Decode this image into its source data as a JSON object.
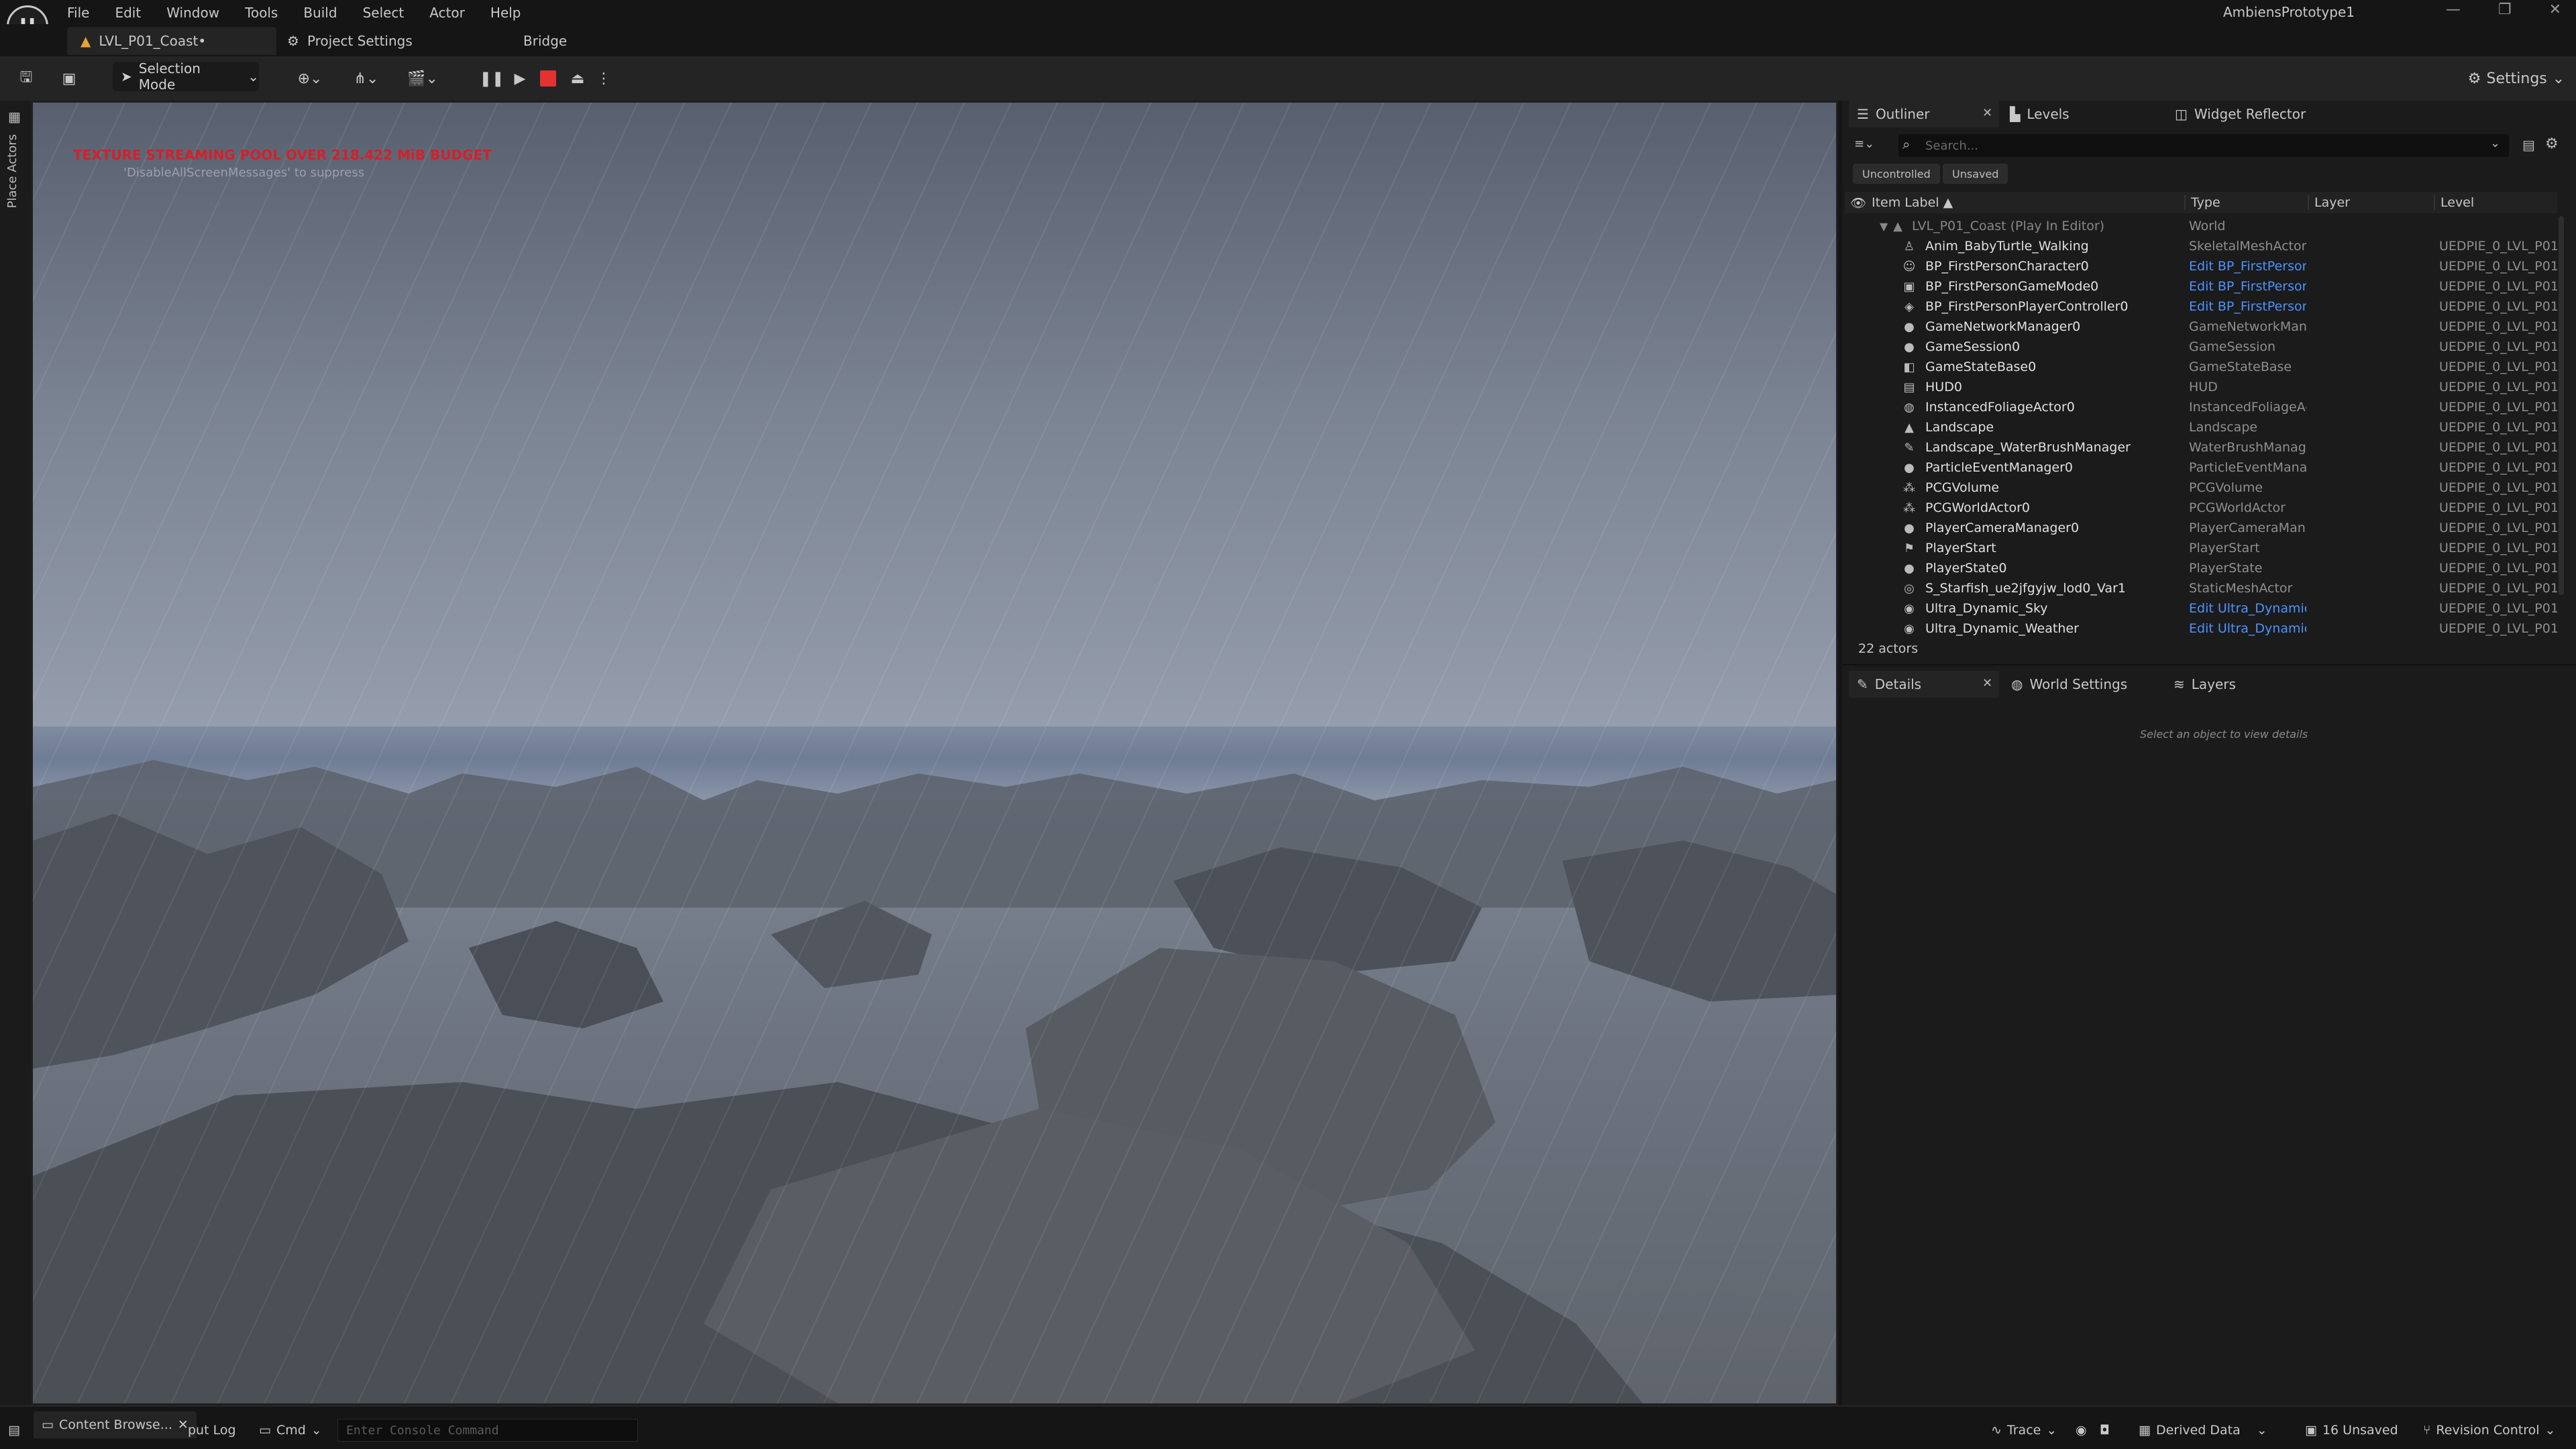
{
  "app": {
    "logo_text": "U",
    "title": "AmbiensPrototype1"
  },
  "menu": [
    "File",
    "Edit",
    "Window",
    "Tools",
    "Build",
    "Select",
    "Actor",
    "Help"
  ],
  "tabs": {
    "level": "LVL_P01_Coast•",
    "project_settings": "Project Settings",
    "bridge": "Bridge"
  },
  "toolbar": {
    "selection_mode": "Selection Mode",
    "settings": "Settings"
  },
  "left_strip": {
    "place_actors": "Place Actors"
  },
  "viewport": {
    "warning": "TEXTURE STREAMING POOL OVER 218.422 MiB BUDGET",
    "hint": "'DisableAllScreenMessages' to suppress"
  },
  "outliner": {
    "tabs": [
      "Outliner",
      "Levels",
      "Widget Reflector"
    ],
    "search_placeholder": "Search...",
    "chips": [
      "Uncontrolled",
      "Unsaved"
    ],
    "columns": {
      "label": "Item Label ▲",
      "type": "Type",
      "layer": "Layer",
      "level": "Level"
    },
    "world_row": {
      "label": "LVL_P01_Coast (Play In Editor)",
      "type": "World"
    },
    "rows": [
      {
        "icon": "skeletal-icon",
        "label": "Anim_BabyTurtle_Walking",
        "type": "SkeletalMeshActor",
        "link": false,
        "level": "UEDPIE_0_LVL_P01"
      },
      {
        "icon": "character-icon",
        "label": "BP_FirstPersonCharacter0",
        "type": "Edit BP_FirstPerson",
        "link": true,
        "level": "UEDPIE_0_LVL_P01"
      },
      {
        "icon": "gamemode-icon",
        "label": "BP_FirstPersonGameMode0",
        "type": "Edit BP_FirstPerson",
        "link": true,
        "level": "UEDPIE_0_LVL_P01"
      },
      {
        "icon": "controller-icon",
        "label": "BP_FirstPersonPlayerController0",
        "type": "Edit BP_FirstPerson",
        "link": true,
        "level": "UEDPIE_0_LVL_P01"
      },
      {
        "icon": "actor-icon",
        "label": "GameNetworkManager0",
        "type": "GameNetworkMana",
        "link": false,
        "level": "UEDPIE_0_LVL_P01"
      },
      {
        "icon": "actor-icon",
        "label": "GameSession0",
        "type": "GameSession",
        "link": false,
        "level": "UEDPIE_0_LVL_P01"
      },
      {
        "icon": "gamestate-icon",
        "label": "GameStateBase0",
        "type": "GameStateBase",
        "link": false,
        "level": "UEDPIE_0_LVL_P01"
      },
      {
        "icon": "hud-icon",
        "label": "HUD0",
        "type": "HUD",
        "link": false,
        "level": "UEDPIE_0_LVL_P01"
      },
      {
        "icon": "foliage-icon",
        "label": "InstancedFoliageActor0",
        "type": "InstancedFoliageAc",
        "link": false,
        "level": "UEDPIE_0_LVL_P01"
      },
      {
        "icon": "landscape-icon",
        "label": "Landscape",
        "type": "Landscape",
        "link": false,
        "level": "UEDPIE_0_LVL_P01"
      },
      {
        "icon": "brush-icon",
        "label": "Landscape_WaterBrushManager",
        "type": "WaterBrushManage",
        "link": false,
        "level": "UEDPIE_0_LVL_P01"
      },
      {
        "icon": "actor-icon",
        "label": "ParticleEventManager0",
        "type": "ParticleEventManag",
        "link": false,
        "level": "UEDPIE_0_LVL_P01"
      },
      {
        "icon": "pcg-icon",
        "label": "PCGVolume",
        "type": "PCGVolume",
        "link": false,
        "level": "UEDPIE_0_LVL_P01"
      },
      {
        "icon": "pcg-icon",
        "label": "PCGWorldActor0",
        "type": "PCGWorldActor",
        "link": false,
        "level": "UEDPIE_0_LVL_P01"
      },
      {
        "icon": "actor-icon",
        "label": "PlayerCameraManager0",
        "type": "PlayerCameraMana",
        "link": false,
        "level": "UEDPIE_0_LVL_P01"
      },
      {
        "icon": "playerstart-icon",
        "label": "PlayerStart",
        "type": "PlayerStart",
        "link": false,
        "level": "UEDPIE_0_LVL_P01"
      },
      {
        "icon": "actor-icon",
        "label": "PlayerState0",
        "type": "PlayerState",
        "link": false,
        "level": "UEDPIE_0_LVL_P01"
      },
      {
        "icon": "mesh-icon",
        "label": "S_Starfish_ue2jfgyjw_lod0_Var1",
        "type": "StaticMeshActor",
        "link": false,
        "level": "UEDPIE_0_LVL_P01"
      },
      {
        "icon": "sphere-icon",
        "label": "Ultra_Dynamic_Sky",
        "type": "Edit Ultra_Dynamic",
        "link": true,
        "level": "UEDPIE_0_LVL_P01"
      },
      {
        "icon": "sphere-icon",
        "label": "Ultra_Dynamic_Weather",
        "type": "Edit Ultra_Dynamic",
        "link": true,
        "level": "UEDPIE_0_LVL_P01"
      }
    ],
    "count": "22 actors"
  },
  "details": {
    "tabs": [
      "Details",
      "World Settings",
      "Layers"
    ],
    "empty_message": "Select an object to view details"
  },
  "statusbar": {
    "content_browser": "Content Browse...",
    "output_log": "put Log",
    "cmd": "Cmd",
    "console_placeholder": "Enter Console Command",
    "trace": "Trace",
    "derived_data": "Derived Data",
    "unsaved": "16 Unsaved",
    "revision_control": "Revision Control"
  }
}
